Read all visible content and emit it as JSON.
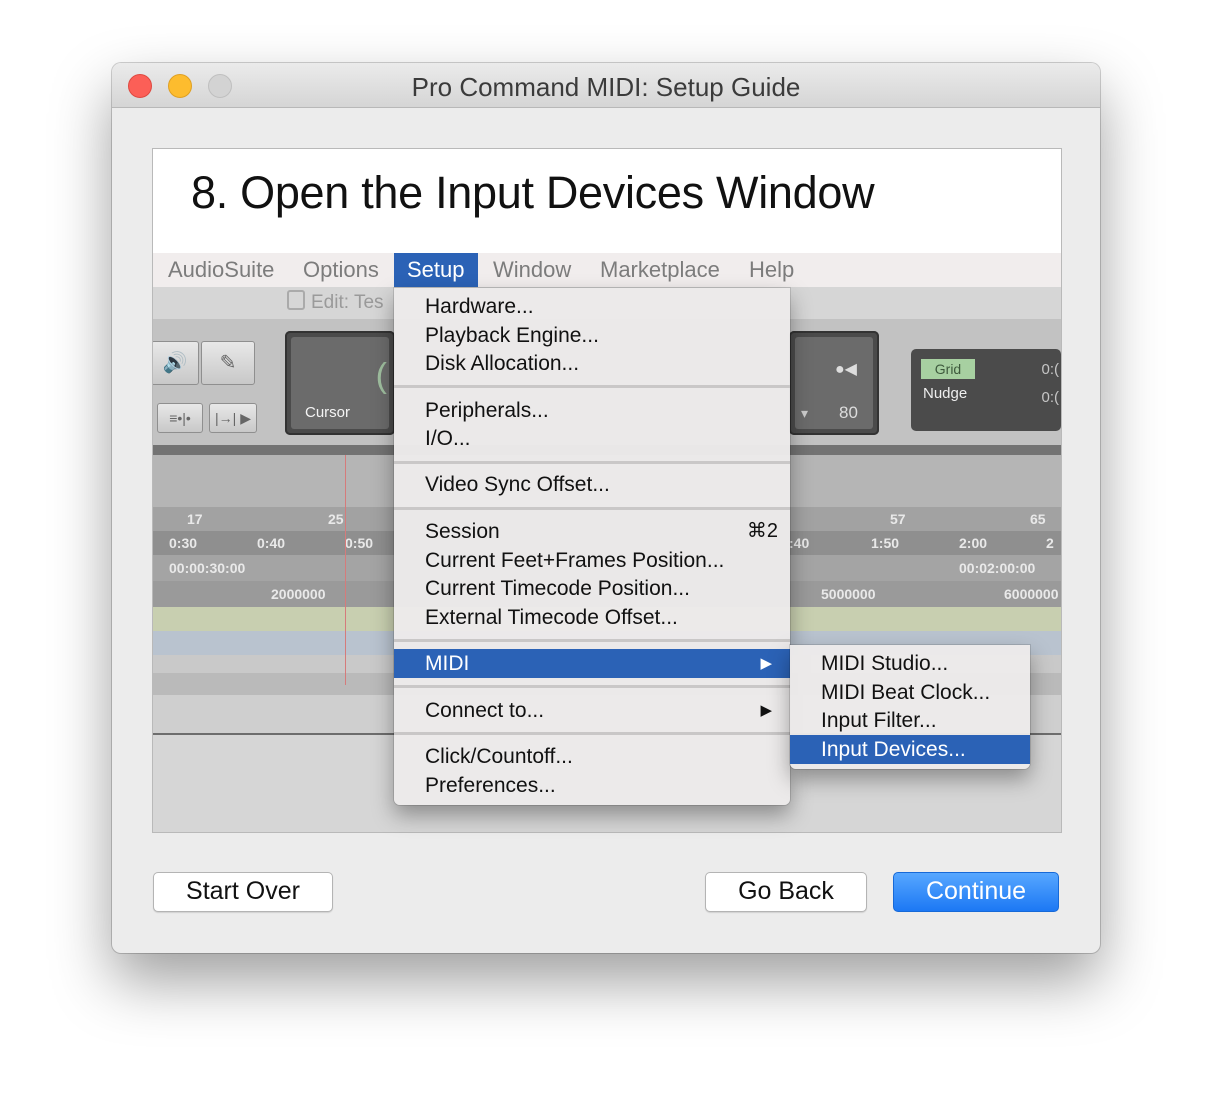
{
  "window": {
    "title": "Pro Command MIDI: Setup Guide"
  },
  "step": {
    "title": "8. Open the Input Devices Window"
  },
  "menubar": {
    "items": [
      "AudioSuite",
      "Options",
      "Setup",
      "Window",
      "Marketplace",
      "Help"
    ],
    "active": "Setup"
  },
  "screenshot": {
    "edit_window_title": "Edit: Tes",
    "counter_label": "Cursor",
    "counter_digit": "(",
    "bpm_value": "80",
    "grid_label": "Grid",
    "nudge_label": "Nudge",
    "grid_value": "0:(",
    "nudge_value": "0:(",
    "bars": [
      "17",
      "25",
      "57",
      "65"
    ],
    "minsecs": [
      "0:30",
      "0:40",
      "0:50",
      ":40",
      "1:50",
      "2:00",
      "2"
    ],
    "timecode": [
      "00:00:30:00",
      "00:02:00:00"
    ],
    "samples": [
      "2000000",
      "5000000",
      "6000000"
    ]
  },
  "setup_menu": {
    "group1": [
      "Hardware...",
      "Playback Engine...",
      "Disk Allocation..."
    ],
    "group2": [
      "Peripherals...",
      "I/O..."
    ],
    "group3": [
      "Video Sync Offset..."
    ],
    "session": "Session",
    "session_shortcut": "⌘2",
    "group4": [
      "Current Feet+Frames Position...",
      "Current Timecode Position...",
      "External Timecode Offset..."
    ],
    "midi": "MIDI",
    "connect_to": "Connect to...",
    "group7": [
      "Click/Countoff...",
      "Preferences..."
    ],
    "submenu_arrow": "▶"
  },
  "midi_submenu": {
    "items": [
      "MIDI Studio...",
      "MIDI Beat Clock...",
      "Input Filter...",
      "Input Devices..."
    ],
    "highlighted": "Input Devices..."
  },
  "buttons": {
    "start_over": "Start Over",
    "go_back": "Go Back",
    "continue": "Continue"
  },
  "colors": {
    "menu_highlight": "#2b62b6",
    "primary_button": "#1c78f4",
    "close": "#fc5f57",
    "minimize": "#fdbc2e"
  }
}
